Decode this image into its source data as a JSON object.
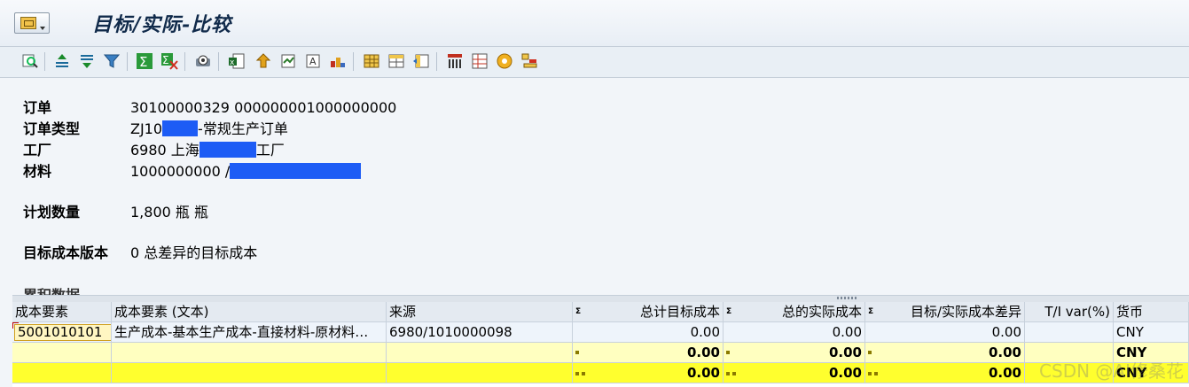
{
  "window": {
    "title": "目标/实际-比较"
  },
  "toolbar": {
    "icons": [
      "details-icon",
      "sort-ascending-icon",
      "sort-descending-icon",
      "filter-icon",
      "sum-icon",
      "subtotal-icon",
      "print-preview-icon",
      "export-icon",
      "find-icon",
      "graphic-icon",
      "mail-icon",
      "abc-analysis-icon",
      "layout-icon",
      "select-layout-icon",
      "save-layout-icon",
      "columns-icon",
      "rows-icon",
      "cost-elements-icon",
      "color-settings-icon"
    ]
  },
  "header": {
    "order_label": "订单",
    "order_value": "30100000329 000000001000000000",
    "order_type_label": "订单类型",
    "order_type_prefix": "ZJ10",
    "order_type_suffix": "-常规生产订单",
    "plant_label": "工厂",
    "plant_prefix": "6980 上海",
    "plant_suffix": "工厂",
    "material_label": "材料",
    "material_prefix": "1000000000 /",
    "material_suffix": "",
    "planned_qty_label": "计划数量",
    "planned_qty_value": "1,800 瓶 瓶",
    "target_version_label": "目标成本版本",
    "target_version_value": "0 总差异的目标成本",
    "cut_label": "累积数据"
  },
  "grid": {
    "columns": [
      "成本要素",
      "成本要素 (文本)",
      "来源",
      "总计目标成本",
      "总的实际成本",
      "目标/实际成本差异",
      "T/I var(%)",
      "货币"
    ],
    "sum_symbol": "Σ",
    "rows": [
      {
        "cost_element": "5001010101",
        "text": "生产成本-基本生产成本-直接材料-原材料…",
        "source": "6980/1010000098",
        "target": "0.00",
        "actual": "0.00",
        "variance": "0.00",
        "pct": "",
        "currency": "CNY"
      }
    ],
    "subtotal": {
      "target": "0.00",
      "actual": "0.00",
      "variance": "0.00",
      "currency": "CNY"
    },
    "total": {
      "target": "0.00",
      "actual": "0.00",
      "variance": "0.00",
      "currency": "CNY"
    }
  },
  "watermark": "CSDN @AI修桑花"
}
